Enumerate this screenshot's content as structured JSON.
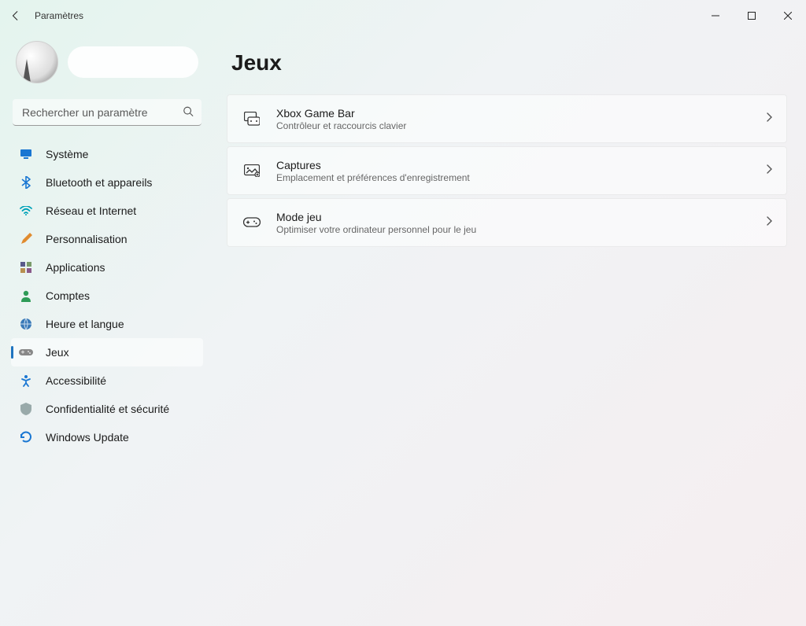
{
  "window": {
    "title": "Paramètres"
  },
  "search": {
    "placeholder": "Rechercher un paramètre"
  },
  "sidebar": {
    "items": [
      {
        "label": "Système"
      },
      {
        "label": "Bluetooth et appareils"
      },
      {
        "label": "Réseau et Internet"
      },
      {
        "label": "Personnalisation"
      },
      {
        "label": "Applications"
      },
      {
        "label": "Comptes"
      },
      {
        "label": "Heure et langue"
      },
      {
        "label": "Jeux"
      },
      {
        "label": "Accessibilité"
      },
      {
        "label": "Confidentialité et sécurité"
      },
      {
        "label": "Windows Update"
      }
    ],
    "selected_index": 7
  },
  "main": {
    "title": "Jeux",
    "cards": [
      {
        "title": "Xbox Game Bar",
        "subtitle": "Contrôleur et raccourcis clavier"
      },
      {
        "title": "Captures",
        "subtitle": "Emplacement et préférences d'enregistrement"
      },
      {
        "title": "Mode jeu",
        "subtitle": "Optimiser votre ordinateur personnel pour le jeu"
      }
    ]
  }
}
